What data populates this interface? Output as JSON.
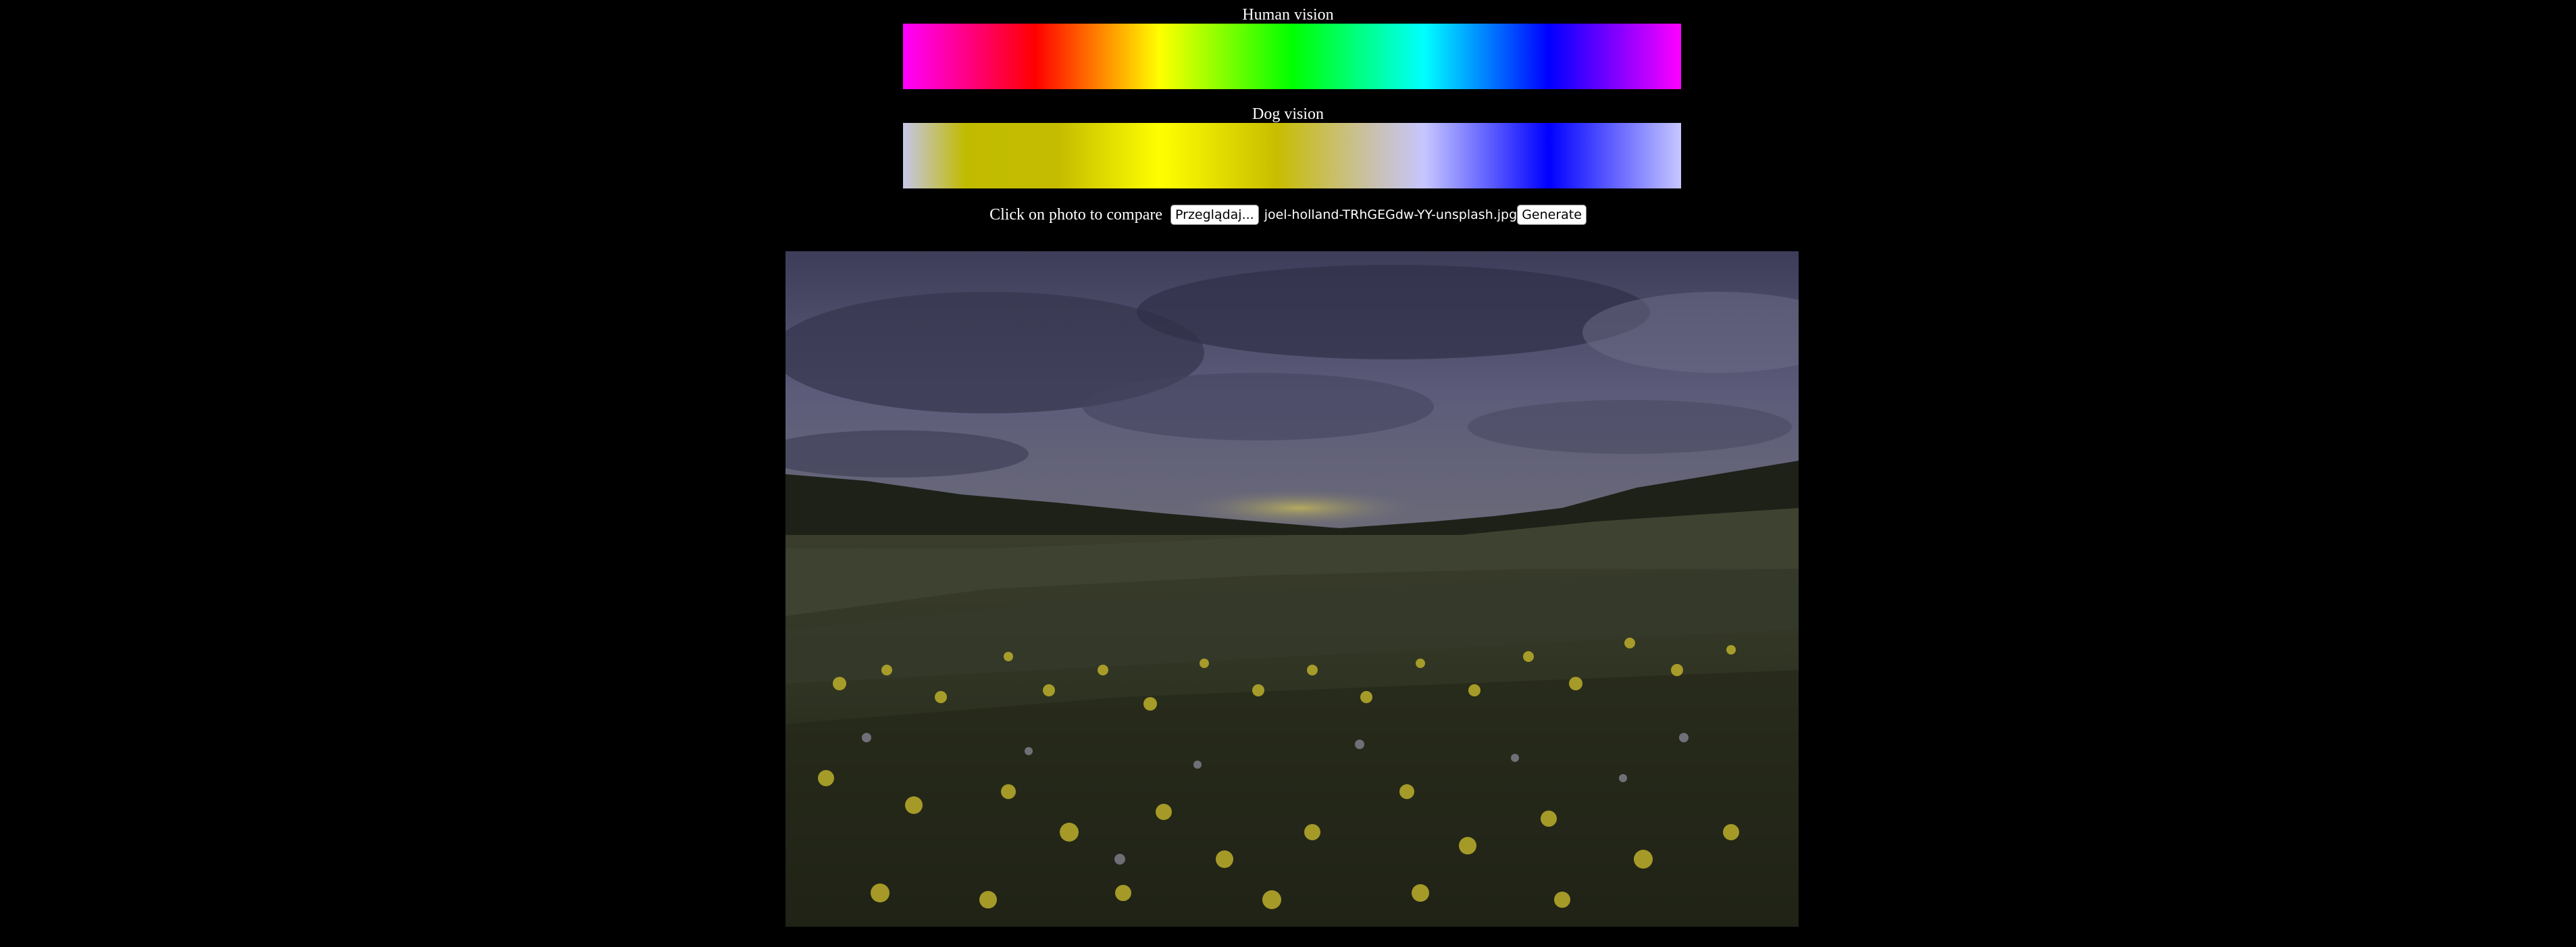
{
  "human": {
    "label": "Human vision"
  },
  "dog": {
    "label": "Dog vision"
  },
  "controls": {
    "compare_text": "Click on photo to compare",
    "browse_label": "Przeglądaj...",
    "file_name": "joel-holland-TRhGEGdw-YY-unsplash.jpg",
    "generate_label": "Generate"
  },
  "colors": {
    "background": "#000000",
    "text": "#ffffff"
  }
}
